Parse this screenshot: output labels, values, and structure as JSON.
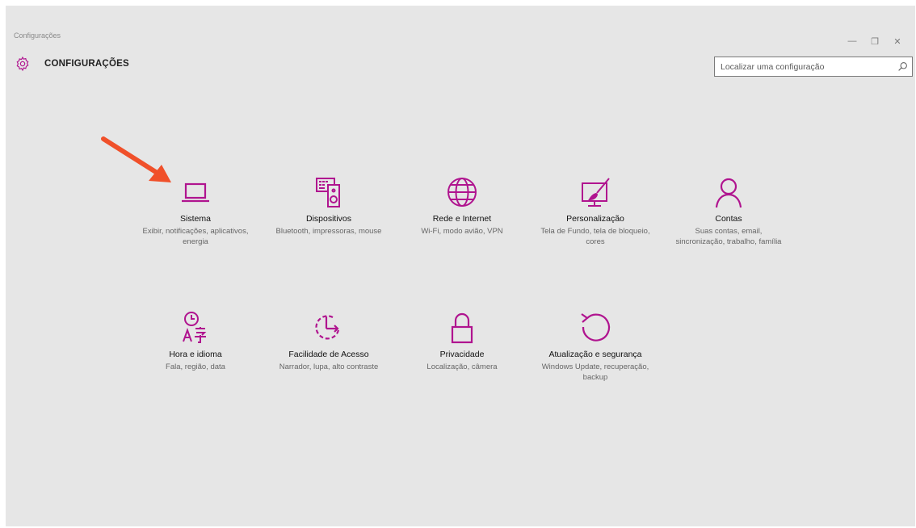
{
  "window": {
    "title": "Configurações",
    "controls": {
      "minimize": "—",
      "restore": "❐",
      "close": "✕"
    }
  },
  "header": {
    "title": "CONFIGURAÇÕES",
    "search_placeholder": "Localizar uma configuração",
    "search_value": ""
  },
  "colors": {
    "accent": "#b0148f",
    "arrow": "#f0502a",
    "background": "#e6e6e6"
  },
  "tiles": [
    {
      "name": "Sistema",
      "desc": "Exibir, notificações, aplicativos, energia",
      "icon": "laptop-icon"
    },
    {
      "name": "Dispositivos",
      "desc": "Bluetooth, impressoras, mouse",
      "icon": "devices-icon"
    },
    {
      "name": "Rede e Internet",
      "desc": "Wi-Fi, modo avião, VPN",
      "icon": "globe-icon"
    },
    {
      "name": "Personalização",
      "desc": "Tela de Fundo, tela de bloqueio, cores",
      "icon": "paintbrush-icon"
    },
    {
      "name": "Contas",
      "desc": "Suas contas, email, sincronização, trabalho, família",
      "icon": "person-icon"
    },
    {
      "name": "Hora e idioma",
      "desc": "Fala, região, data",
      "icon": "time-language-icon"
    },
    {
      "name": "Facilidade de Acesso",
      "desc": "Narrador, lupa, alto contraste",
      "icon": "ease-of-access-icon"
    },
    {
      "name": "Privacidade",
      "desc": "Localização, câmera",
      "icon": "lock-icon"
    },
    {
      "name": "Atualização e segurança",
      "desc": "Windows Update, recuperação, backup",
      "icon": "refresh-icon"
    }
  ]
}
